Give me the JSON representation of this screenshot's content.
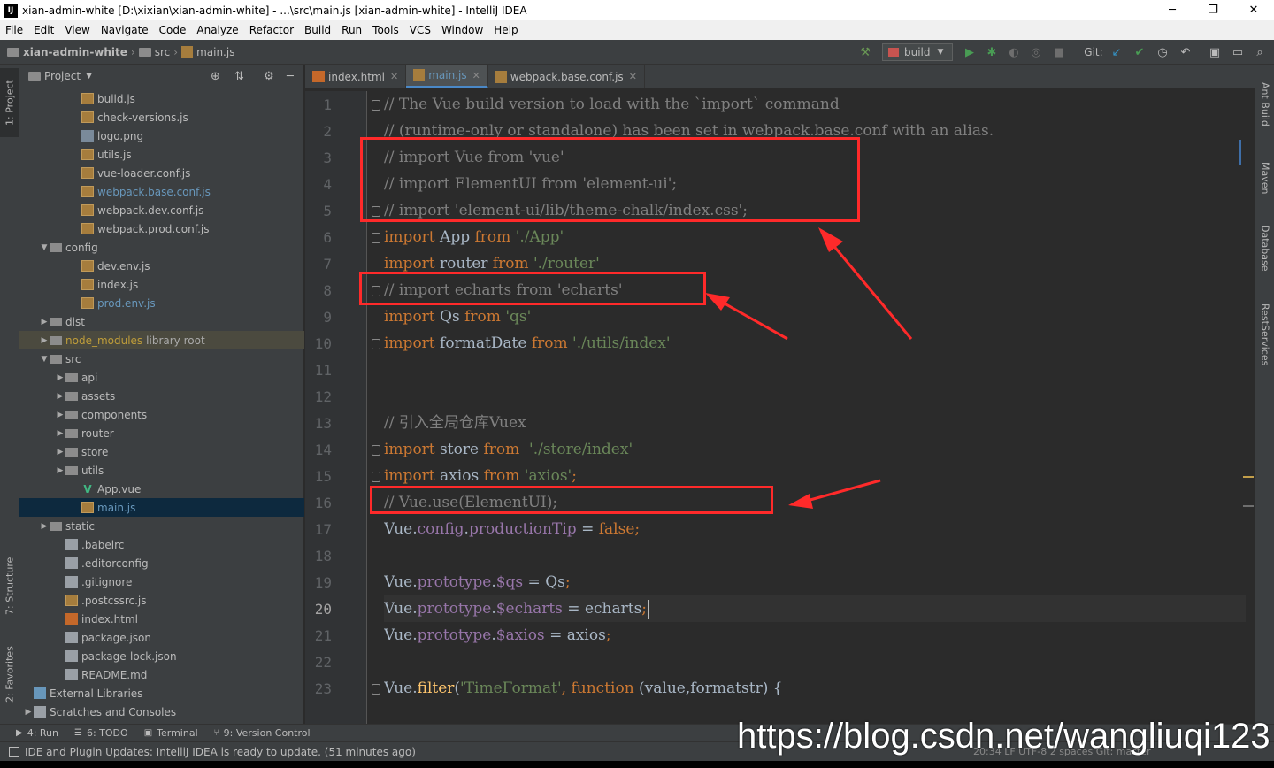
{
  "titlebar": {
    "title": "xian-admin-white [D:\\xixian\\xian-admin-white] - ...\\src\\main.js [xian-admin-white] - IntelliJ IDEA",
    "minimize": "─",
    "maximize": "❐",
    "close": "✕"
  },
  "menu": [
    "File",
    "Edit",
    "View",
    "Navigate",
    "Code",
    "Analyze",
    "Refactor",
    "Build",
    "Run",
    "Tools",
    "VCS",
    "Window",
    "Help"
  ],
  "breadcrumb": {
    "project": "xian-admin-white",
    "folder": "src",
    "file": "main.js"
  },
  "toolbar": {
    "run_config": "build",
    "git_label": "Git:"
  },
  "left_strip": {
    "project_tab": "1: Project",
    "structure_tab": "7: Structure",
    "favorites_tab": "2: Favorites"
  },
  "right_strip": {
    "ant": "Ant Build",
    "maven": "Maven",
    "database": "Database",
    "rest": "RestServices"
  },
  "project_panel": {
    "title": "Project",
    "tree": [
      {
        "label": "build.js",
        "type": "js",
        "depth": 3
      },
      {
        "label": "check-versions.js",
        "type": "js",
        "depth": 3
      },
      {
        "label": "logo.png",
        "type": "png",
        "depth": 3
      },
      {
        "label": "utils.js",
        "type": "js",
        "depth": 3
      },
      {
        "label": "vue-loader.conf.js",
        "type": "js",
        "depth": 3
      },
      {
        "label": "webpack.base.conf.js",
        "type": "js",
        "depth": 3,
        "blue": true
      },
      {
        "label": "webpack.dev.conf.js",
        "type": "js",
        "depth": 3
      },
      {
        "label": "webpack.prod.conf.js",
        "type": "js",
        "depth": 3
      },
      {
        "label": "config",
        "type": "folder",
        "depth": 1,
        "open": true
      },
      {
        "label": "dev.env.js",
        "type": "js",
        "depth": 3
      },
      {
        "label": "index.js",
        "type": "js",
        "depth": 3
      },
      {
        "label": "prod.env.js",
        "type": "js",
        "depth": 3,
        "blue": true
      },
      {
        "label": "dist",
        "type": "folder",
        "depth": 1,
        "open": false
      },
      {
        "label": "node_modules",
        "extra": "library root",
        "type": "folder",
        "depth": 1,
        "open": false,
        "nm": true
      },
      {
        "label": "src",
        "type": "folder",
        "depth": 1,
        "open": true
      },
      {
        "label": "api",
        "type": "folder",
        "depth": 2,
        "open": false
      },
      {
        "label": "assets",
        "type": "folder",
        "depth": 2,
        "open": false
      },
      {
        "label": "components",
        "type": "folder",
        "depth": 2,
        "open": false
      },
      {
        "label": "router",
        "type": "folder",
        "depth": 2,
        "open": false
      },
      {
        "label": "store",
        "type": "folder",
        "depth": 2,
        "open": false
      },
      {
        "label": "utils",
        "type": "folder",
        "depth": 2,
        "open": false
      },
      {
        "label": "App.vue",
        "type": "vue",
        "depth": 3
      },
      {
        "label": "main.js",
        "type": "js",
        "depth": 3,
        "selected": true,
        "blue": true
      },
      {
        "label": "static",
        "type": "folder",
        "depth": 1,
        "open": false
      },
      {
        "label": ".babelrc",
        "type": "gen",
        "depth": 2
      },
      {
        "label": ".editorconfig",
        "type": "gen",
        "depth": 2
      },
      {
        "label": ".gitignore",
        "type": "gen",
        "depth": 2
      },
      {
        "label": ".postcssrc.js",
        "type": "js",
        "depth": 2
      },
      {
        "label": "index.html",
        "type": "html",
        "depth": 2
      },
      {
        "label": "package.json",
        "type": "gen",
        "depth": 2
      },
      {
        "label": "package-lock.json",
        "type": "gen",
        "depth": 2
      },
      {
        "label": "README.md",
        "type": "gen",
        "depth": 2
      },
      {
        "label": "External Libraries",
        "type": "lib",
        "depth": 0
      },
      {
        "label": "Scratches and Consoles",
        "type": "gen",
        "depth": 0,
        "open": false
      }
    ]
  },
  "editor_tabs": [
    {
      "label": "index.html",
      "active": false
    },
    {
      "label": "main.js",
      "active": true
    },
    {
      "label": "webpack.base.conf.js",
      "active": false
    }
  ],
  "code_lines": [
    [
      [
        "cmt",
        "// The Vue build version to load with the `import` command"
      ]
    ],
    [
      [
        "cmt",
        "// (runtime-only or standalone) has been set in webpack.base.conf with an alias."
      ]
    ],
    [
      [
        "cmt",
        "// import Vue from 'vue'"
      ]
    ],
    [
      [
        "cmt",
        "// import ElementUI from 'element-ui';"
      ]
    ],
    [
      [
        "cmt",
        "// import 'element-ui/lib/theme-chalk/index.css';"
      ]
    ],
    [
      [
        "kw",
        "import "
      ],
      [
        "t",
        "App "
      ],
      [
        "kw",
        "from "
      ],
      [
        "str",
        "'./App'"
      ]
    ],
    [
      [
        "kw",
        "import "
      ],
      [
        "t",
        "router "
      ],
      [
        "kw",
        "from "
      ],
      [
        "str",
        "'./router'"
      ]
    ],
    [
      [
        "cmt",
        "// import echarts from 'echarts'"
      ]
    ],
    [
      [
        "kw",
        "import "
      ],
      [
        "t",
        "Qs "
      ],
      [
        "kw",
        "from "
      ],
      [
        "str",
        "'qs'"
      ]
    ],
    [
      [
        "kw",
        "import "
      ],
      [
        "t",
        "formatDate "
      ],
      [
        "kw",
        "from "
      ],
      [
        "str",
        "'./utils/index'"
      ]
    ],
    [],
    [],
    [
      [
        "cmt",
        "// 引入全局仓库Vuex"
      ]
    ],
    [
      [
        "kw",
        "import "
      ],
      [
        "t",
        "store "
      ],
      [
        "kw",
        "from  "
      ],
      [
        "str",
        "'./store/index'"
      ]
    ],
    [
      [
        "kw",
        "import "
      ],
      [
        "t",
        "axios "
      ],
      [
        "kw",
        "from "
      ],
      [
        "str",
        "'axios'"
      ],
      [
        "kw",
        ";"
      ]
    ],
    [
      [
        "cmt",
        "// Vue.use(ElementUI);"
      ]
    ],
    [
      [
        "t",
        "Vue."
      ],
      [
        "prop",
        "config"
      ],
      [
        "t",
        "."
      ],
      [
        "prop",
        "productionTip "
      ],
      [
        "t",
        "= "
      ],
      [
        "kw",
        "false;"
      ]
    ],
    [],
    [
      [
        "t",
        "Vue."
      ],
      [
        "prop",
        "prototype"
      ],
      [
        "t",
        "."
      ],
      [
        "prop",
        "$qs "
      ],
      [
        "t",
        "= Qs"
      ],
      [
        "kw",
        ";"
      ]
    ],
    [
      [
        "t",
        "Vue."
      ],
      [
        "prop",
        "prototype"
      ],
      [
        "t",
        "."
      ],
      [
        "prop",
        "$echarts "
      ],
      [
        "t",
        "= echarts"
      ],
      [
        "kw",
        ";"
      ]
    ],
    [
      [
        "t",
        "Vue."
      ],
      [
        "prop",
        "prototype"
      ],
      [
        "t",
        "."
      ],
      [
        "prop",
        "$axios "
      ],
      [
        "t",
        "= axios"
      ],
      [
        "kw",
        ";"
      ]
    ],
    [],
    [
      [
        "t",
        "Vue."
      ],
      [
        "fn",
        "filter"
      ],
      [
        "t",
        "("
      ],
      [
        "str",
        "'TimeFormat'"
      ],
      [
        "kw",
        ", function "
      ],
      [
        "t",
        "(value,formatstr) {"
      ]
    ]
  ],
  "bottom_tabs": [
    "4: Run",
    "6: TODO",
    "Terminal",
    "9: Version Control"
  ],
  "status_text": "IDE and Plugin Updates: IntelliJ IDEA is ready to update. (51 minutes ago)",
  "status_right": "20:34  LF  UTF-8  2 spaces  Git: master",
  "watermark": "https://blog.csdn.net/wangliuqi123"
}
